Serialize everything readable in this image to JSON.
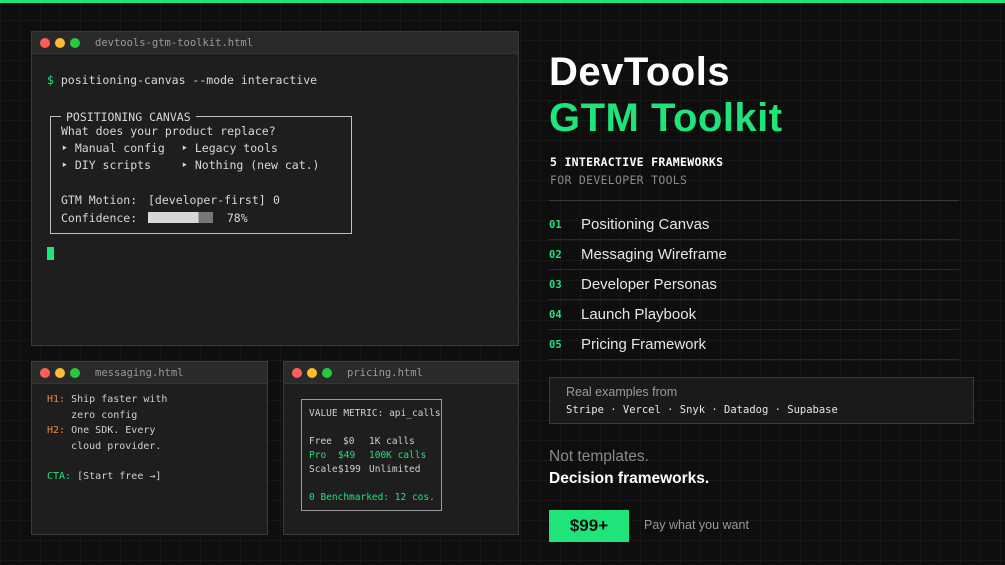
{
  "colors": {
    "accent": "#1ee47a",
    "background": "#0e0e0e",
    "window": "#1e1e1e",
    "label_orange": "#f08a3c"
  },
  "main_window": {
    "title": "devtools-gtm-toolkit.html",
    "prompt": "$",
    "command": "positioning-canvas --mode interactive",
    "canvas": {
      "legend": "POSITIONING CANVAS",
      "question": "What does your product replace?",
      "options": [
        "‣ Manual config",
        "‣ Legacy tools",
        "‣ DIY scripts",
        "‣ Nothing (new cat.)"
      ],
      "motion_label": "GTM Motion:",
      "motion_value": "[developer-first]",
      "motion_mark": "0",
      "confidence_label": "Confidence:",
      "confidence_value": "78%",
      "confidence_fraction": 0.78
    }
  },
  "messaging_window": {
    "title": "messaging.html",
    "h1_label": "H1:",
    "h1_line1": "Ship faster with",
    "h1_line2": "zero config",
    "h2_label": "H2:",
    "h2_line1": "One SDK. Every",
    "h2_line2": "cloud provider.",
    "cta_label": "CTA:",
    "cta_value": "[Start free →]"
  },
  "pricing_window": {
    "title": "pricing.html",
    "metric_line": "VALUE METRIC: api_calls",
    "rows": [
      {
        "tier": "Free",
        "price": "$0",
        "calls": "1K calls"
      },
      {
        "tier": "Pro",
        "price": "$49",
        "calls": "100K calls"
      },
      {
        "tier": "Scale",
        "price": "$199",
        "calls": "Unlimited"
      }
    ],
    "benchmark": "0 Benchmarked: 12 cos."
  },
  "hero": {
    "title_line1": "DevTools",
    "title_line2": "GTM Toolkit",
    "subtitle1": "5 INTERACTIVE FRAMEWORKS",
    "subtitle2": "FOR DEVELOPER TOOLS"
  },
  "frameworks": [
    {
      "num": "01",
      "label": "Positioning Canvas"
    },
    {
      "num": "02",
      "label": "Messaging Wireframe"
    },
    {
      "num": "03",
      "label": "Developer Personas"
    },
    {
      "num": "04",
      "label": "Launch Playbook"
    },
    {
      "num": "05",
      "label": "Pricing Framework"
    }
  ],
  "examples": {
    "heading": "Real examples from",
    "companies": "Stripe · Vercel · Snyk · Datadog · Supabase"
  },
  "tagline": {
    "line1": "Not templates.",
    "line2": "Decision frameworks."
  },
  "pricing": {
    "price": "$99+",
    "note": "Pay what you want"
  }
}
